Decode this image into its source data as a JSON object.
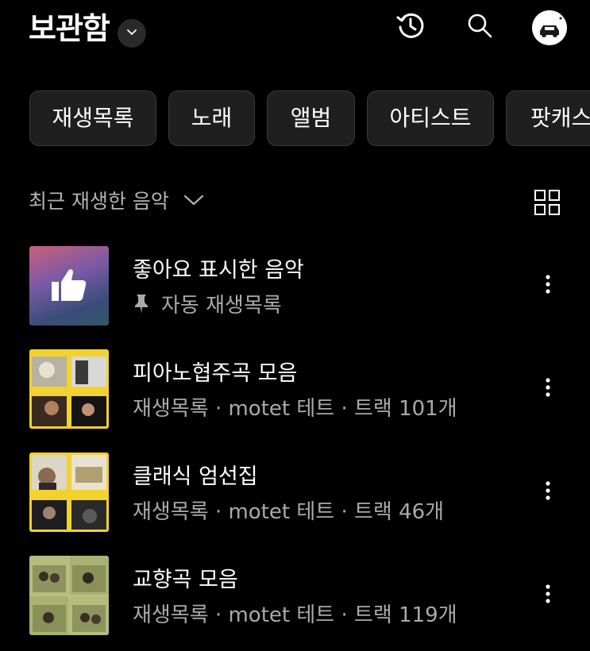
{
  "header": {
    "title": "보관함",
    "icons": [
      "chevron-down-icon",
      "history-icon",
      "search-icon",
      "avatar"
    ]
  },
  "chips": [
    {
      "label": "재생목록"
    },
    {
      "label": "노래"
    },
    {
      "label": "앨범"
    },
    {
      "label": "아티스트"
    },
    {
      "label": "팟캐스"
    }
  ],
  "sort": {
    "label": "최근 재생한 음악"
  },
  "items": [
    {
      "title": "좋아요 표시한 음악",
      "subtitle": "자동 재생목록",
      "pinned": true,
      "thumb": "thumbs-up-icon"
    },
    {
      "title": "피아노협주곡 모음",
      "subtitle": "재생목록 · motet 테트 · 트랙 101개",
      "thumb": "album-collage"
    },
    {
      "title": "클래식 엄선집",
      "subtitle": "재생목록 · motet 테트 · 트랙 46개",
      "thumb": "album-collage"
    },
    {
      "title": "교향곡 모음",
      "subtitle": "재생목록 · motet 테트 · 트랙 119개",
      "thumb": "album-collage"
    }
  ],
  "colors": {
    "background": "#000000",
    "chip_bg": "#1f1f1f",
    "chip_border": "#3a3a3a",
    "secondary_text": "#aaaaaa",
    "album_yellow": "#f2d22e"
  }
}
